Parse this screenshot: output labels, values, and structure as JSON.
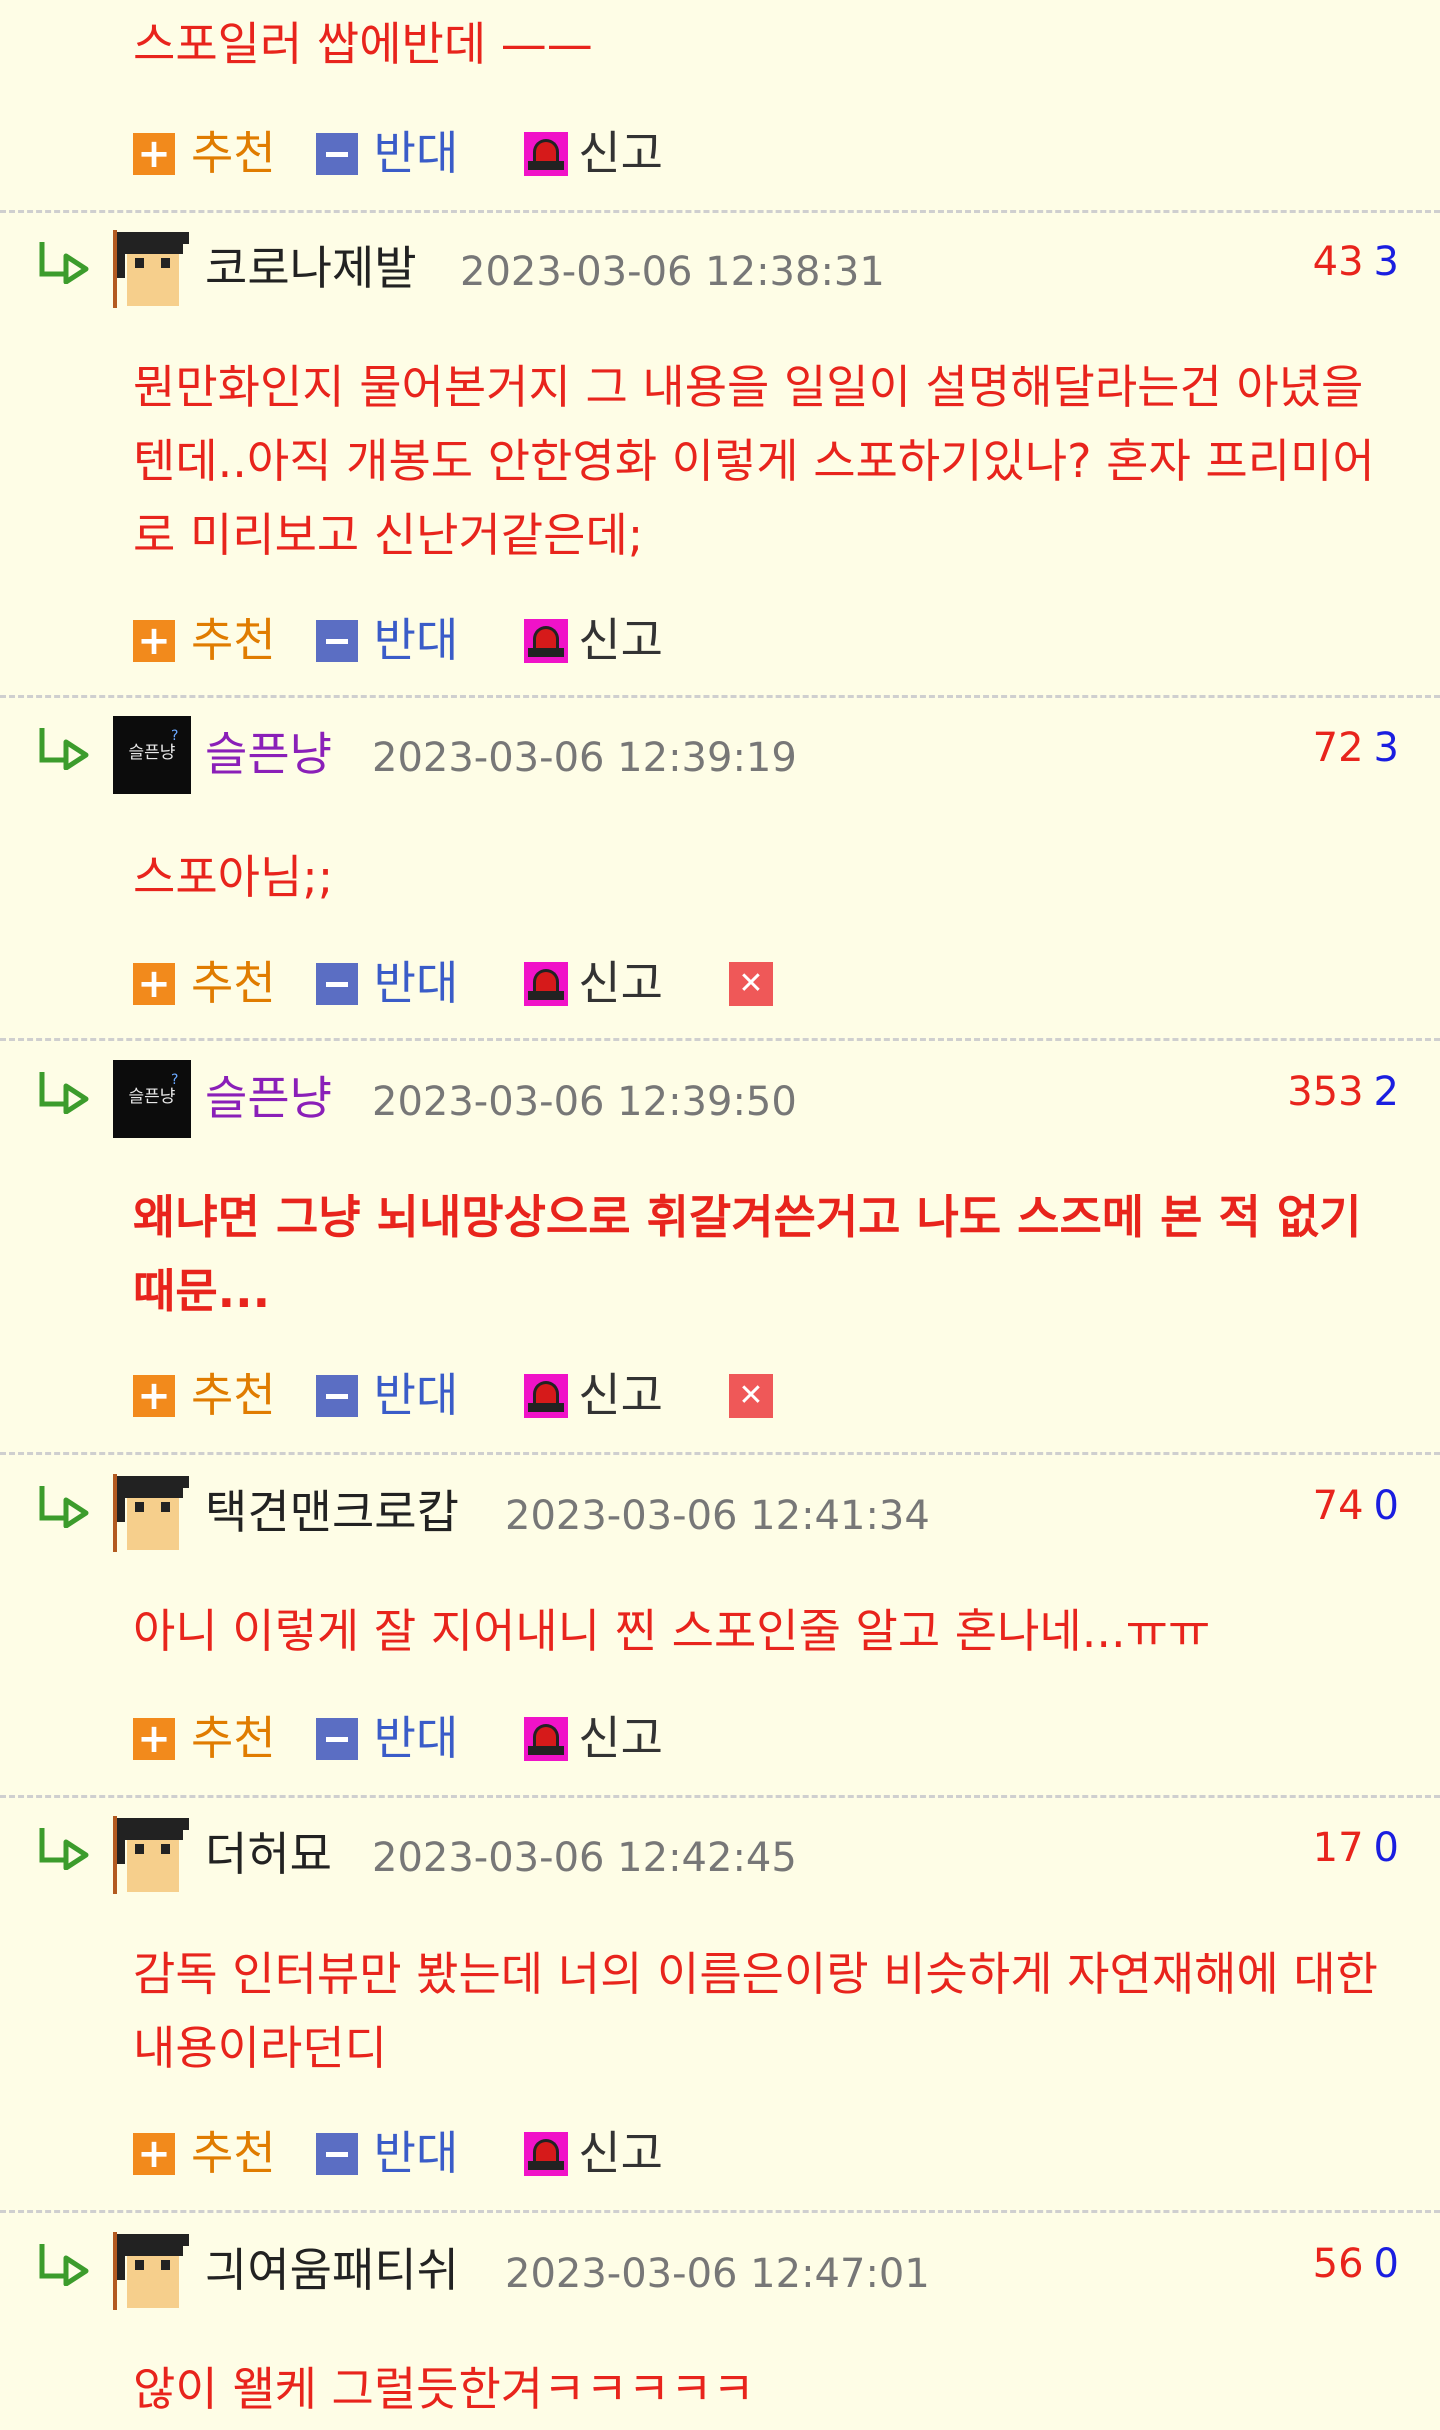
{
  "actions": {
    "recommend_label": "추천",
    "oppose_label": "반대",
    "report_label": "신고"
  },
  "top_comment": {
    "text": "스포일러 쌉에반데 ——"
  },
  "comments": [
    {
      "nickname": "코로나제발",
      "datetime": "2023-03-06 12:38:31",
      "upvotes": "43",
      "downvotes": "3",
      "text": "뭔만화인지 물어본거지 그 내용을 일일이 설명해달라는건 아녔을텐데..아직 개봉도 안한영화 이렇게 스포하기있나? 혼자 프리미어로 미리보고 신난거같은데;"
    },
    {
      "nickname": "슬픈냥",
      "datetime": "2023-03-06 12:39:19",
      "upvotes": "72",
      "downvotes": "3",
      "text": "스포아님;;"
    },
    {
      "nickname": "슬픈냥",
      "datetime": "2023-03-06 12:39:50",
      "upvotes": "353",
      "downvotes": "2",
      "text": "왜냐면 그냥 뇌내망상으로 휘갈겨쓴거고 나도 스즈메 본 적 없기 때문..."
    },
    {
      "nickname": "택견맨크로캅",
      "datetime": "2023-03-06 12:41:34",
      "upvotes": "74",
      "downvotes": "0",
      "text": "아니 이렇게 잘 지어내니 찐 스포인줄 알고 혼나네...ㅠㅠ"
    },
    {
      "nickname": "더허묘",
      "datetime": "2023-03-06 12:42:45",
      "upvotes": "17",
      "downvotes": "0",
      "text": "감독 인터뷰만 봤는데 너의 이름은이랑 비슷하게 자연재해에 대한 내용이라던디"
    },
    {
      "nickname": "긔여움패티쉬",
      "datetime": "2023-03-06 12:47:01",
      "upvotes": "56",
      "downvotes": "0",
      "text": "않이 왤케 그럴듯한겨ㅋㅋㅋㅋㅋ"
    }
  ],
  "avatar_sad_cat_text": "슬픈냥",
  "colors": {
    "background": "#fefde6",
    "comment_text": "#e8241c",
    "downvote": "#1a1ee0",
    "recommend": "#e07c00",
    "oppose": "#3a5cc8",
    "purple_nick": "#8a1fb8"
  }
}
